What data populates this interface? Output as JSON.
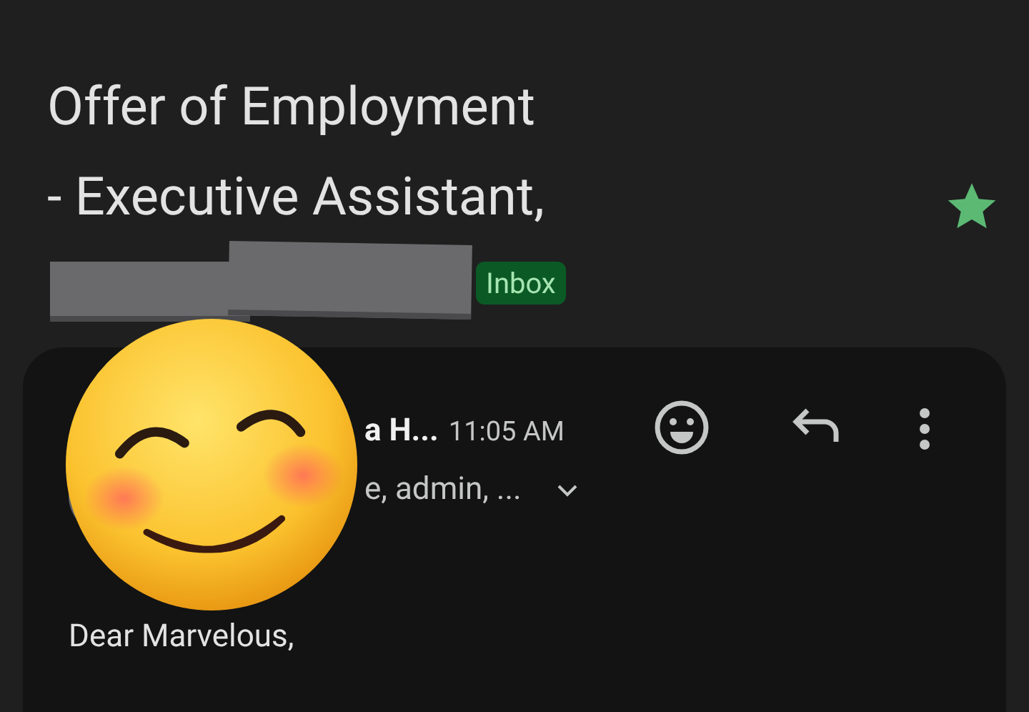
{
  "subject": {
    "lines": [
      "Offer of Employment",
      "- Executive Assistant,"
    ],
    "starred": true,
    "label": "Inbox"
  },
  "message": {
    "sender": "a H...",
    "time": "11:05 AM",
    "recipients": "e, admin, ...",
    "greeting": "Dear Marvelous,"
  }
}
